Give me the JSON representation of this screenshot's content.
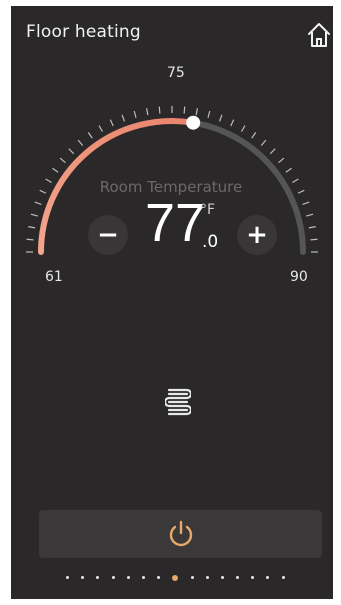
{
  "header": {
    "title": "Floor heating"
  },
  "dial": {
    "min_label": "61",
    "max_label": "90",
    "mid_label": "75",
    "min": 61,
    "max": 90,
    "setpoint": 77,
    "accent_color": "#f0a08a",
    "track_color": "#555555"
  },
  "readout": {
    "caption": "Room Temperature",
    "value": "77",
    "unit": "°F",
    "decimal": ".0",
    "minus_label": "−",
    "plus_label": "+"
  },
  "icons": {
    "home": "home-icon",
    "heating_coil": "heating-coil-icon",
    "power": "power-icon"
  },
  "pager": {
    "count": 15,
    "active_index": 7,
    "active_color": "#e8a86a"
  }
}
